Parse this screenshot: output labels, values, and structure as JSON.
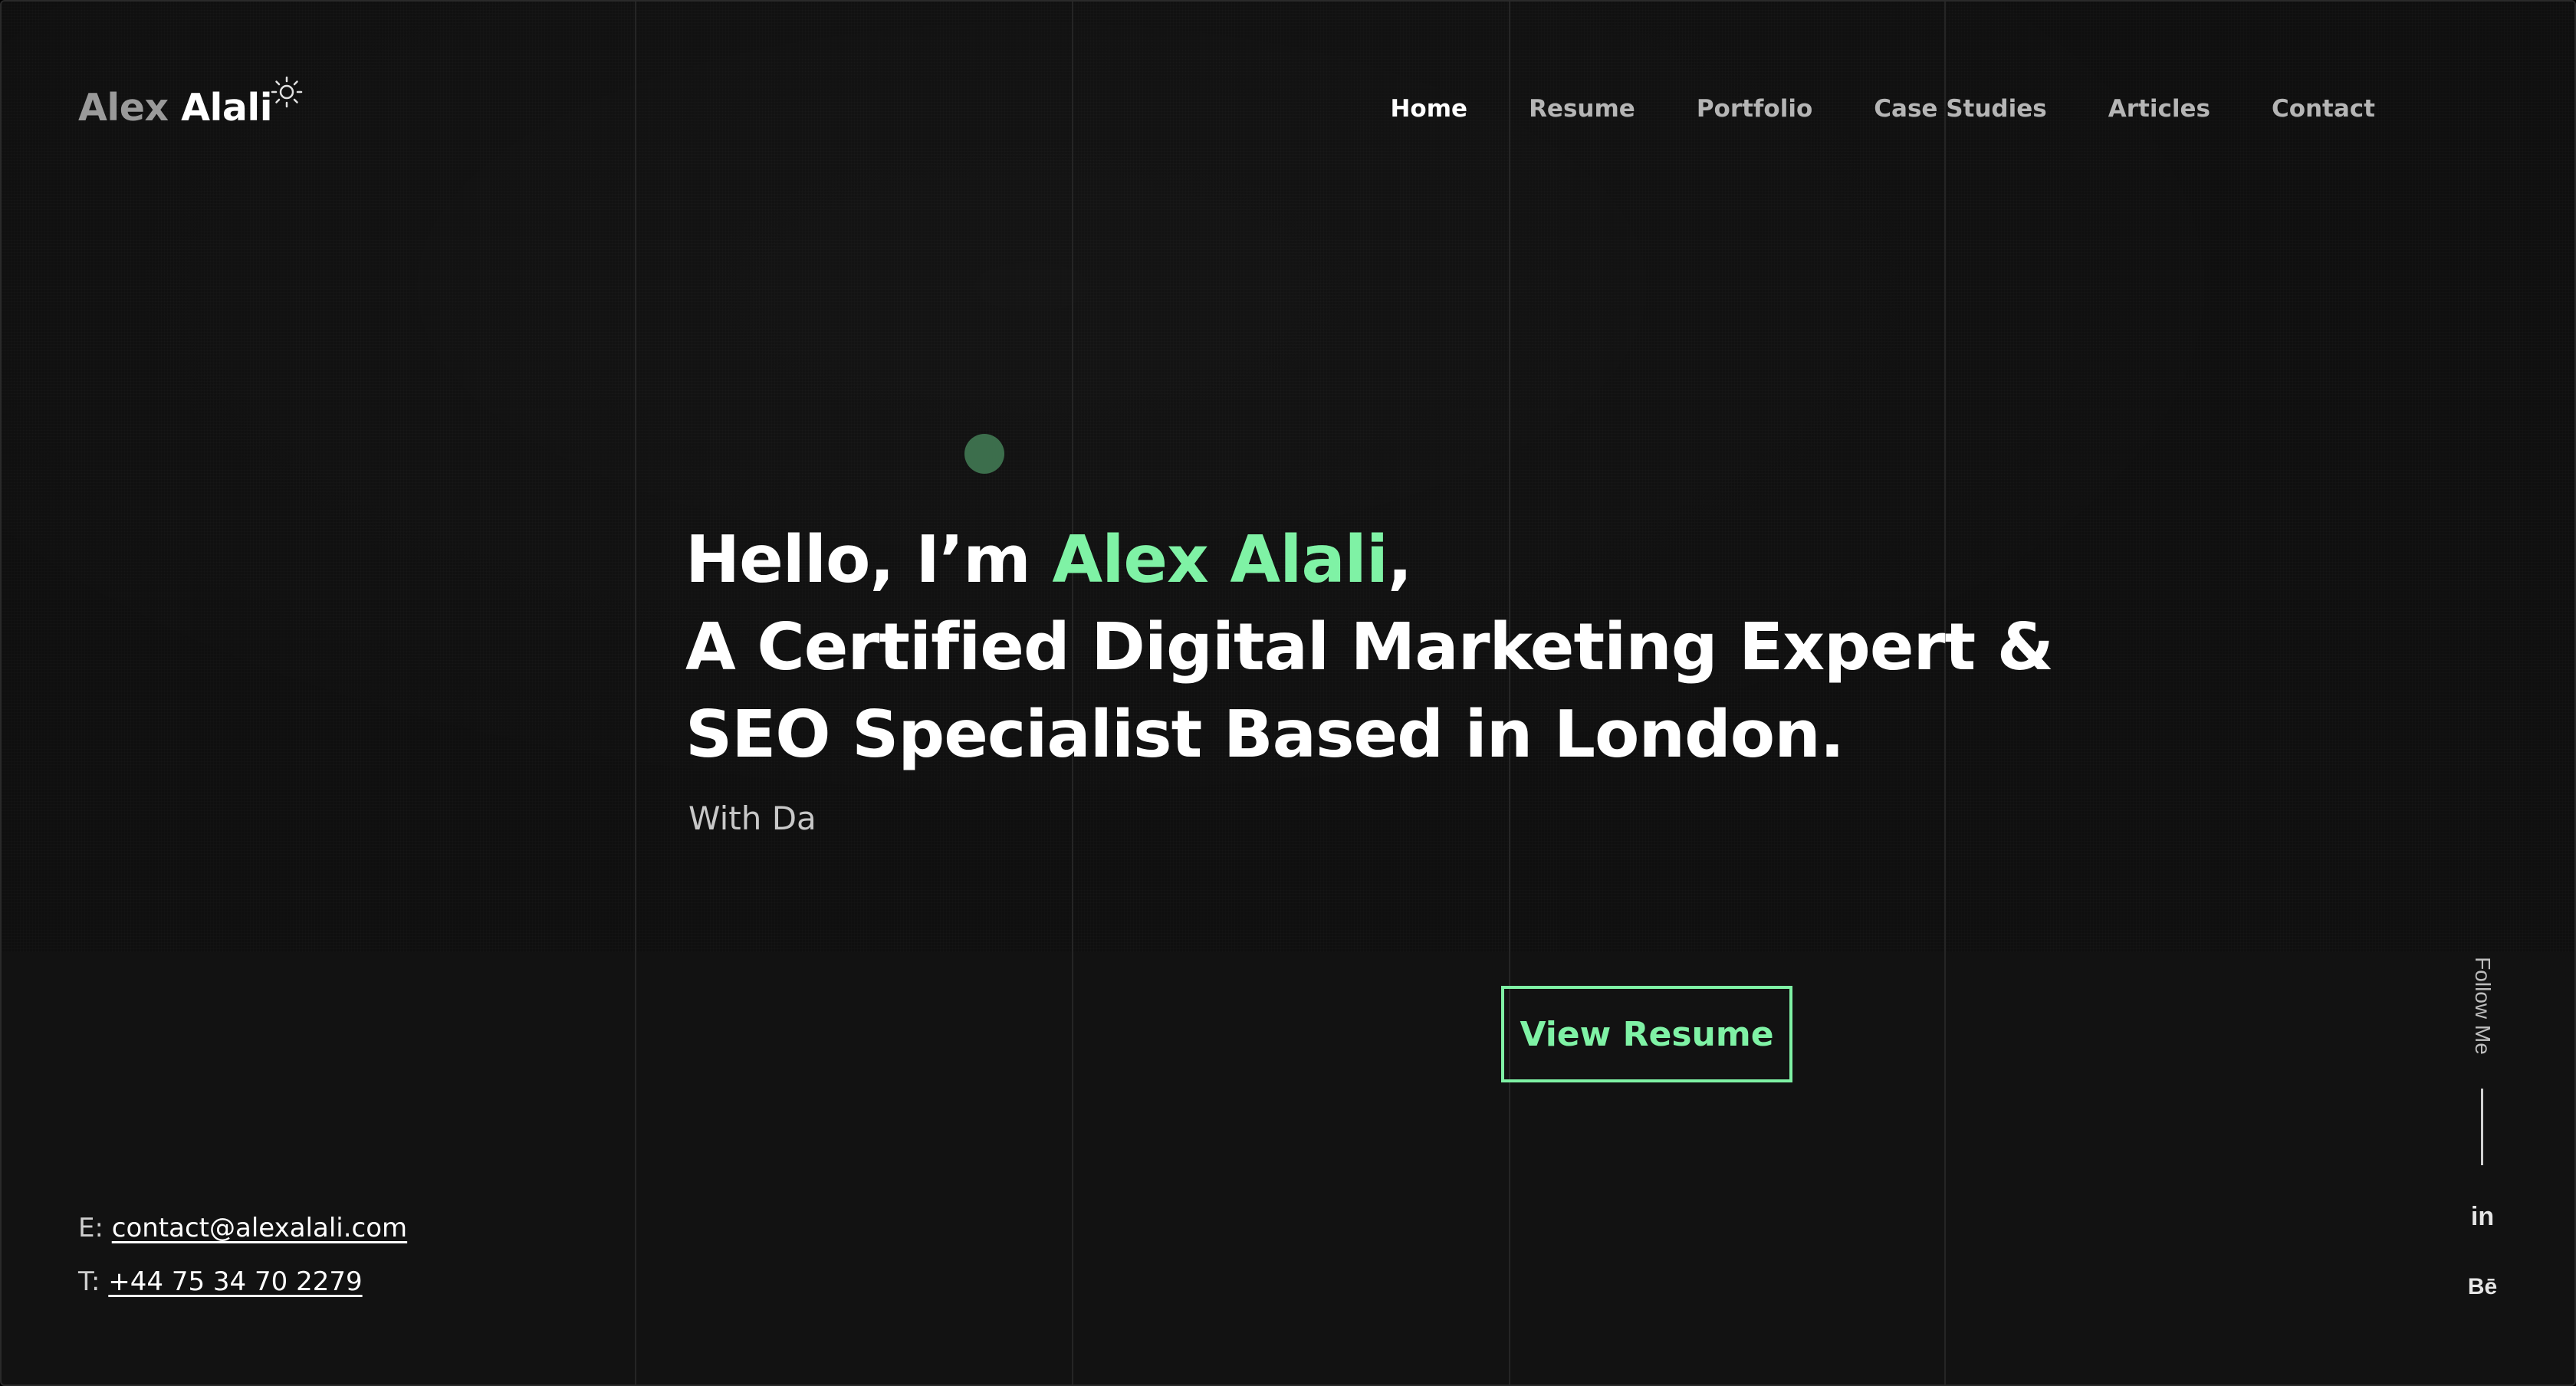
{
  "brand": {
    "first": "Alex",
    "last": "Alali"
  },
  "theme_toggle": {
    "icon": "sun-icon"
  },
  "nav": {
    "items": [
      {
        "label": "Home",
        "active": true
      },
      {
        "label": "Resume",
        "active": false
      },
      {
        "label": "Portfolio",
        "active": false
      },
      {
        "label": "Case Studies",
        "active": false
      },
      {
        "label": "Articles",
        "active": false
      },
      {
        "label": "Contact",
        "active": false
      }
    ]
  },
  "hero": {
    "greeting": "Hello, I’m ",
    "name": "Alex Alali",
    "comma": ",",
    "line2": "A Certified Digital Marketing Expert &",
    "line3": "SEO Specialist Based in London.",
    "typing": "With Da",
    "cta_label": "View Resume"
  },
  "contact": {
    "email_prefix": "E: ",
    "email": "contact@alexalali.com",
    "phone_prefix": "T: ",
    "phone": "+44 75 34 70 2279"
  },
  "social": {
    "follow_label": "Follow Me",
    "linkedin_label": "in",
    "behance_label": "Bē"
  },
  "colors": {
    "accent": "#7ff2a5",
    "background": "#121212",
    "dot": "#3c6e4c"
  }
}
